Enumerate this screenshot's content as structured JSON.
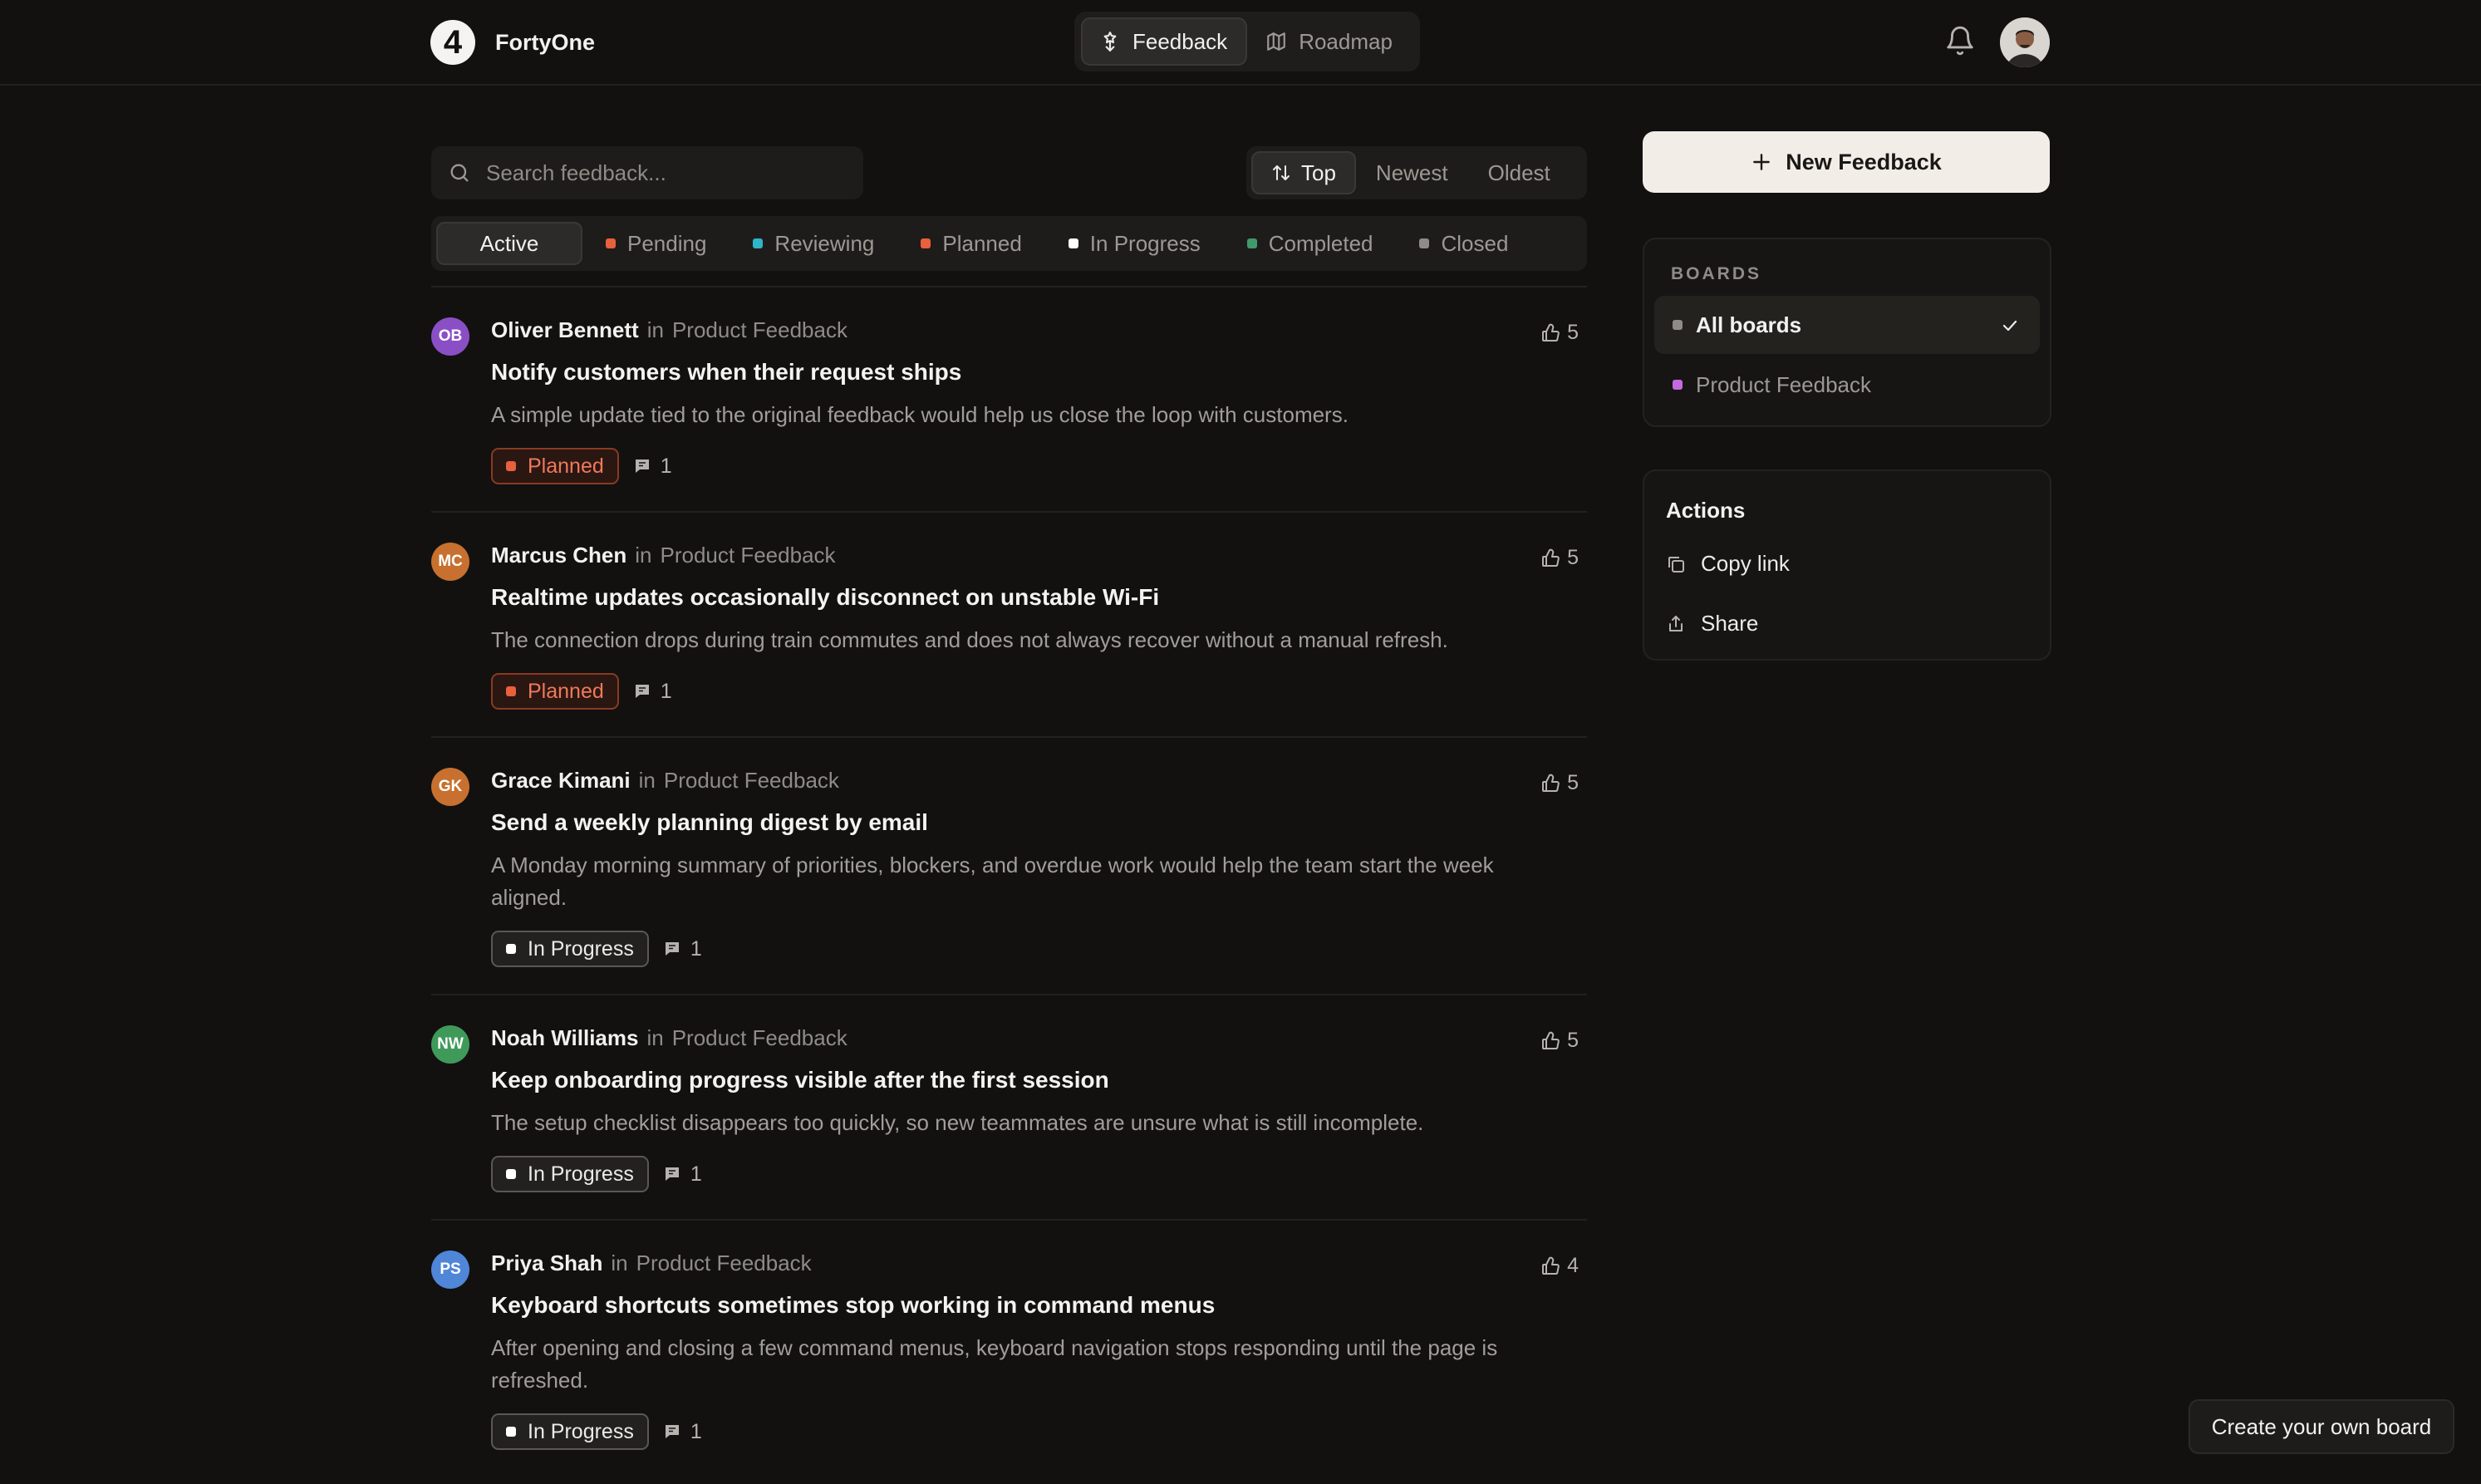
{
  "header": {
    "brand_logo": "4",
    "brand_name": "FortyOne",
    "nav": [
      {
        "label": "Feedback",
        "icon": "feedback-icon",
        "active": true
      },
      {
        "label": "Roadmap",
        "icon": "map-icon",
        "active": false
      }
    ],
    "bell_icon": "bell-icon",
    "avatar_icon": "user-avatar"
  },
  "search": {
    "placeholder": "Search feedback...",
    "value": ""
  },
  "sort": {
    "options": [
      "Top",
      "Newest",
      "Oldest"
    ],
    "selected": "Top"
  },
  "status_filters": [
    {
      "label": "Active",
      "color": null,
      "active": true
    },
    {
      "label": "Pending",
      "color": "#e8603c"
    },
    {
      "label": "Reviewing",
      "color": "#2fb5c9"
    },
    {
      "label": "Planned",
      "color": "#e8603c"
    },
    {
      "label": "In Progress",
      "color": "#ffffff"
    },
    {
      "label": "Completed",
      "color": "#3f9a6a"
    },
    {
      "label": "Closed",
      "color": "#8f8b87"
    }
  ],
  "posts": [
    {
      "initials": "OB",
      "avatar_color": "#8a4fc4",
      "author": "Oliver Bennett",
      "in_word": "in",
      "board": "Product Feedback",
      "title": "Notify customers when their request ships",
      "description": "A simple update tied to the original feedback would help us close the loop with customers.",
      "status": "Planned",
      "comments": "1",
      "votes": "5"
    },
    {
      "initials": "MC",
      "avatar_color": "#c7702f",
      "author": "Marcus Chen",
      "in_word": "in",
      "board": "Product Feedback",
      "title": "Realtime updates occasionally disconnect on unstable Wi-Fi",
      "description": "The connection drops during train commutes and does not always recover without a manual refresh.",
      "status": "Planned",
      "comments": "1",
      "votes": "5"
    },
    {
      "initials": "GK",
      "avatar_color": "#c7702f",
      "author": "Grace Kimani",
      "in_word": "in",
      "board": "Product Feedback",
      "title": "Send a weekly planning digest by email",
      "description": "A Monday morning summary of priorities, blockers, and overdue work would help the team start the week aligned.",
      "status": "In Progress",
      "comments": "1",
      "votes": "5"
    },
    {
      "initials": "NW",
      "avatar_color": "#3f9a5a",
      "author": "Noah Williams",
      "in_word": "in",
      "board": "Product Feedback",
      "title": "Keep onboarding progress visible after the first session",
      "description": "The setup checklist disappears too quickly, so new teammates are unsure what is still incomplete.",
      "status": "In Progress",
      "comments": "1",
      "votes": "5"
    },
    {
      "initials": "PS",
      "avatar_color": "#4f86d8",
      "author": "Priya Shah",
      "in_word": "in",
      "board": "Product Feedback",
      "title": "Keyboard shortcuts sometimes stop working in command menus",
      "description": "After opening and closing a few command menus, keyboard navigation stops responding until the page is refreshed.",
      "status": "In Progress",
      "comments": "1",
      "votes": "4"
    }
  ],
  "sidebar": {
    "new_feedback_label": "New Feedback",
    "boards_heading": "BOARDS",
    "boards": [
      {
        "label": "All boards",
        "color": "#8f8b87",
        "active": true
      },
      {
        "label": "Product Feedback",
        "color": "#c46adf",
        "active": false
      }
    ],
    "actions_heading": "Actions",
    "actions": [
      {
        "label": "Copy link",
        "icon": "copy-icon"
      },
      {
        "label": "Share",
        "icon": "share-icon"
      }
    ]
  },
  "cta_label": "Create your own board"
}
